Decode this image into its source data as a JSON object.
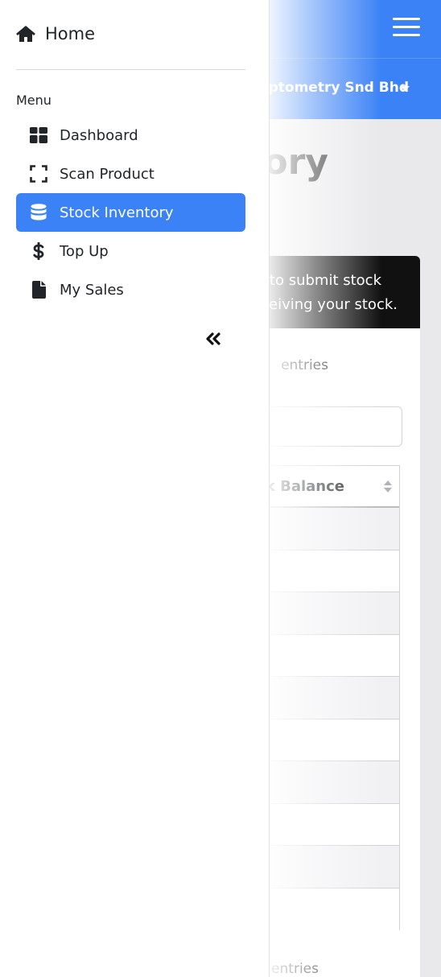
{
  "header": {
    "company": "Optometry Snd Bhd"
  },
  "page": {
    "title": "Stock Inventory",
    "notice_line1": "to submit stock",
    "notice_line2": "eiving your stock.",
    "entries_top": "entries",
    "column_header": "ck Balance",
    "entries_bottom": "entries"
  },
  "sidebar": {
    "home": "Home",
    "menu_label": "Menu",
    "items": [
      {
        "label": "Dashboard",
        "icon": "dashboard-icon"
      },
      {
        "label": "Scan Product",
        "icon": "scan-icon"
      },
      {
        "label": "Stock Inventory",
        "icon": "database-icon",
        "active": true
      },
      {
        "label": "Top Up",
        "icon": "dollar-icon"
      },
      {
        "label": "My Sales",
        "icon": "file-icon"
      }
    ],
    "collapse_icon": "double-chevron-left-icon"
  },
  "colors": {
    "primary": "#3b82f6",
    "notice_bg": "#111111"
  }
}
